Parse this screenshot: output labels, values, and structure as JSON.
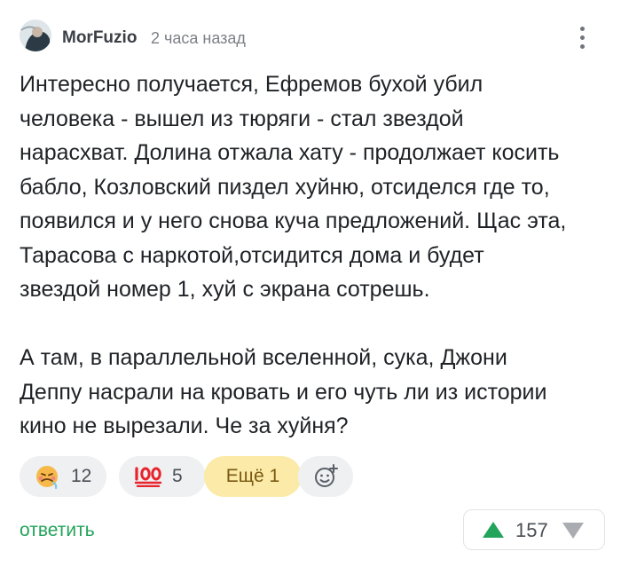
{
  "comment": {
    "author": "MorFuzio",
    "time": "2 часа назад",
    "text": "Интересно получается, Ефремов бухой убил\nчеловека - вышел из тюряги - стал звездой\nнарасхват. Долина отжала хату - продолжает косить\nбабло, Козловский пиздел хуйню, отсиделся где то,\nпоявился и у него снова куча предложений. Щас эта,\nТарасова с наркотой,отсидится дома и будет\nзвездой номер 1, хуй с экрана сотрешь.\n\nА там, в параллельной вселенной, сука, Джони\nДеппу насрали на кровать и его чуть ли из истории\nкино не вырезали. Че за хуйня?"
  },
  "reactions": [
    {
      "icon": "sick-face-emoji-icon",
      "count": "12"
    },
    {
      "icon": "hundred-points-emoji-icon",
      "count": "5"
    }
  ],
  "more_reactions_label": "Ещё 1",
  "add_reaction_icon": "add-reaction-icon",
  "actions": {
    "reply_label": "ответить",
    "rating": "157"
  },
  "colors": {
    "accent_green": "#23a45a",
    "more_chip_bg": "#fbeaa8",
    "chip_bg": "#eef0f2"
  }
}
